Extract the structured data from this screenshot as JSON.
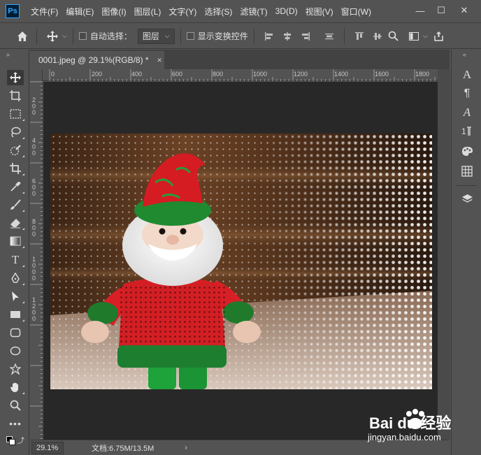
{
  "app": {
    "logo_text": "Ps"
  },
  "menu": {
    "items": [
      "文件(F)",
      "编辑(E)",
      "图像(I)",
      "图层(L)",
      "文字(Y)",
      "选择(S)",
      "滤镜(T)",
      "3D(D)",
      "视图(V)",
      "窗口(W)"
    ]
  },
  "window_controls": {
    "minimize": "—",
    "maximize": "☐",
    "close": "✕"
  },
  "options": {
    "auto_select_label": "自动选择：",
    "auto_select_target": "图层",
    "show_transform_label": "显示变换控件"
  },
  "document": {
    "tab_title": "0001.jpeg @ 29.1%(RGB/8) *",
    "tab_close": "×",
    "zoom": "29.1%",
    "doc_info": "文档:6.75M/13.5M",
    "ruler_h_labels": [
      "0",
      "200",
      "400",
      "600",
      "800",
      "1000",
      "1200",
      "1400",
      "1600",
      "1800"
    ],
    "ruler_v_labels": [
      "2\n0\n0",
      "4\n0\n0",
      "6\n0\n0",
      "8\n0\n0",
      "1\n0\n0\n0",
      "1\n2\n0\n0"
    ]
  },
  "colors": {
    "ui_bg": "#535353",
    "canvas_bg": "#282828",
    "accent": "#31a8ff"
  },
  "icons": {
    "left_tools": [
      "move-tool-icon",
      "artboard-tool-icon",
      "rect-marquee-icon",
      "lasso-icon",
      "quick-select-icon",
      "crop-icon",
      "eyedropper-icon",
      "brush-icon",
      "eraser-icon",
      "gradient-icon",
      "type-tool-icon",
      "pen-tool-icon",
      "path-select-icon",
      "rectangle-shape-icon",
      "rounded-rect-icon",
      "ellipse-icon",
      "custom-shape-icon",
      "hand-tool-icon",
      "zoom-tool-icon",
      "more-tools-icon",
      "color-swatches-icon"
    ],
    "right_panels": [
      "character-icon",
      "paragraph-icon",
      "glyphs-icon",
      "paragraph-styles-icon",
      "swatches-palette-icon",
      "grid-icon",
      "layers-icon"
    ]
  },
  "watermark": {
    "brand": "Bai du 经验",
    "url": "jingyan.baidu.com"
  }
}
